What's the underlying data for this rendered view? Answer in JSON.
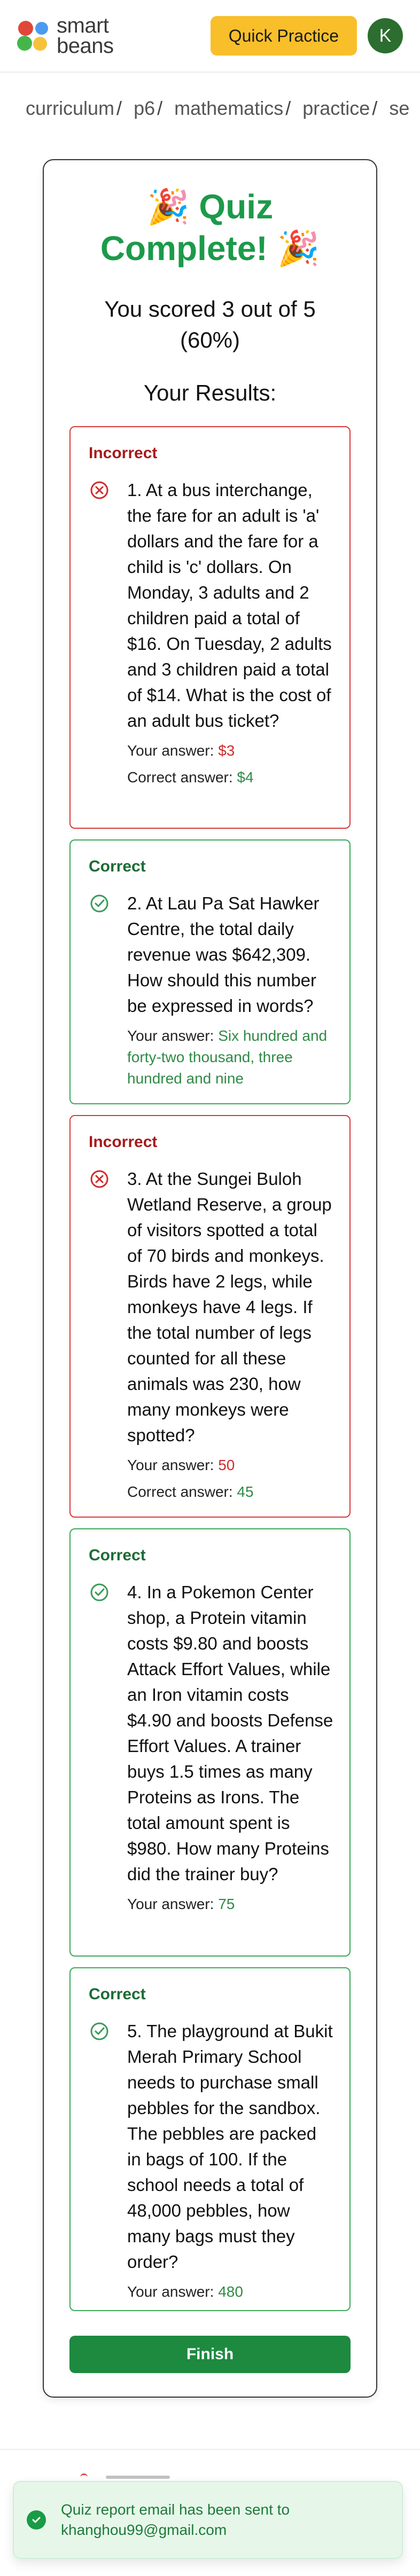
{
  "header": {
    "logo_line1": "smart",
    "logo_line2": "beans",
    "quick_practice_label": "Quick Practice",
    "avatar_initial": "K"
  },
  "breadcrumb": [
    "curriculum",
    "p6",
    "mathematics",
    "practice",
    "se"
  ],
  "quiz": {
    "title_line1": "🎉 Quiz",
    "title_line2": "Complete! 🎉",
    "score_line1": "You scored 3 out of 5",
    "score_line2": "(60%)",
    "results_heading": "Your Results:",
    "your_answer_label": "Your answer:",
    "correct_answer_label": "Correct answer:",
    "questions": [
      {
        "status": "Incorrect",
        "text": "1. At a bus interchange, the fare for an adult is 'a' dollars and the fare for a child is 'c' dollars. On Monday, 3 adults and 2 children paid a total of $16. On Tuesday, 2 adults and 3 children paid a total of $14. What is the cost of an adult bus ticket?",
        "your_answer": "$3",
        "correct_answer": "$4"
      },
      {
        "status": "Correct",
        "text": "2. At Lau Pa Sat Hawker Centre, the total daily revenue was $642,309. How should this number be expressed in words?",
        "your_answer": "Six hundred and forty-two thousand, three hundred and nine"
      },
      {
        "status": "Incorrect",
        "text": "3. At the Sungei Buloh Wetland Reserve, a group of visitors spotted a total of 70 birds and monkeys. Birds have 2 legs, while monkeys have 4 legs. If the total number of legs counted for all these animals was 230, how many monkeys were spotted?",
        "your_answer": "50",
        "correct_answer": "45"
      },
      {
        "status": "Correct",
        "text": "4. In a Pokemon Center shop, a Protein vitamin costs $9.80 and boosts Attack Effort Values, while an Iron vitamin costs $4.90 and boosts Defense Effort Values. A trainer buys 1.5 times as many Proteins as Irons. The total amount spent is $980. How many Proteins did the trainer buy?",
        "your_answer": "75"
      },
      {
        "status": "Correct",
        "text": "5. The playground at Bukit Merah Primary School needs to purchase small pebbles for the sandbox. The pebbles are packed in bags of 100. If the school needs a total of 48,000 pebbles, how many bags must they order?",
        "your_answer": "480"
      }
    ],
    "finish_label": "Finish"
  },
  "toast": {
    "line1": "Quiz report email has been sent to",
    "line2": "khanghou99@gmail.com"
  },
  "colors": {
    "accent_green": "#1c9a4a",
    "incorrect_red": "#d73a3a",
    "quick_practice_yellow": "#f8bf2b",
    "finish_green": "#1d8a40"
  }
}
